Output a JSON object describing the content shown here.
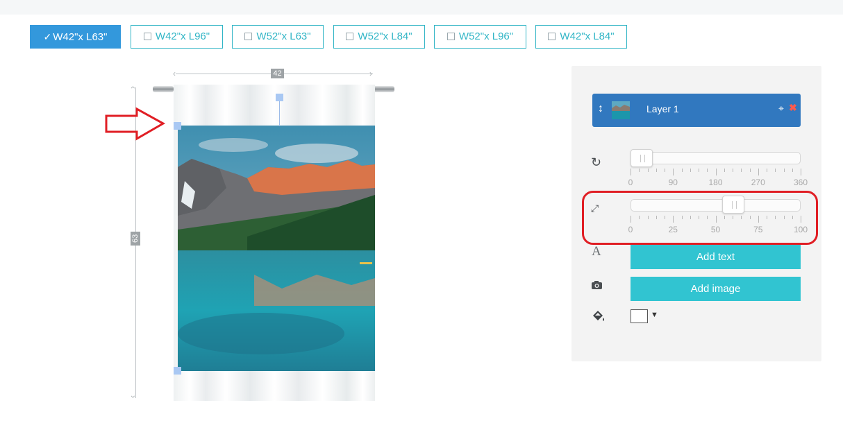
{
  "size_tabs": [
    {
      "label": "W42\"x L63\"",
      "selected": true
    },
    {
      "label": "W42\"x L96\"",
      "selected": false
    },
    {
      "label": "W52\"x L63\"",
      "selected": false
    },
    {
      "label": "W52\"x L84\"",
      "selected": false
    },
    {
      "label": "W52\"x L96\"",
      "selected": false
    },
    {
      "label": "W42\"x L84\"",
      "selected": false
    }
  ],
  "canvas": {
    "width_label": "42",
    "height_label": "63"
  },
  "layer": {
    "name": "Layer 1",
    "move_icon": "vertical-move-icon",
    "center_icon": "crosshair-icon",
    "delete_icon": "close-icon"
  },
  "rotate_slider": {
    "icon": "rotate-icon",
    "value": 0,
    "min": 0,
    "max": 360,
    "labels": [
      "0",
      "90",
      "180",
      "270",
      "360"
    ]
  },
  "scale_slider": {
    "icon": "resize-icon",
    "value": 62,
    "min": 0,
    "max": 100,
    "labels": [
      "0",
      "25",
      "50",
      "75",
      "100"
    ]
  },
  "buttons": {
    "add_text": "Add text",
    "add_image": "Add image"
  },
  "icons": {
    "text": "A",
    "image": "camera-icon",
    "fill": "paint-bucket-icon"
  },
  "fill_color": "#ffffff",
  "colors": {
    "accent": "#31c4d1",
    "layer_bg": "#3178bf",
    "selected_tab": "#3398dc",
    "annotation": "#e01e24"
  }
}
